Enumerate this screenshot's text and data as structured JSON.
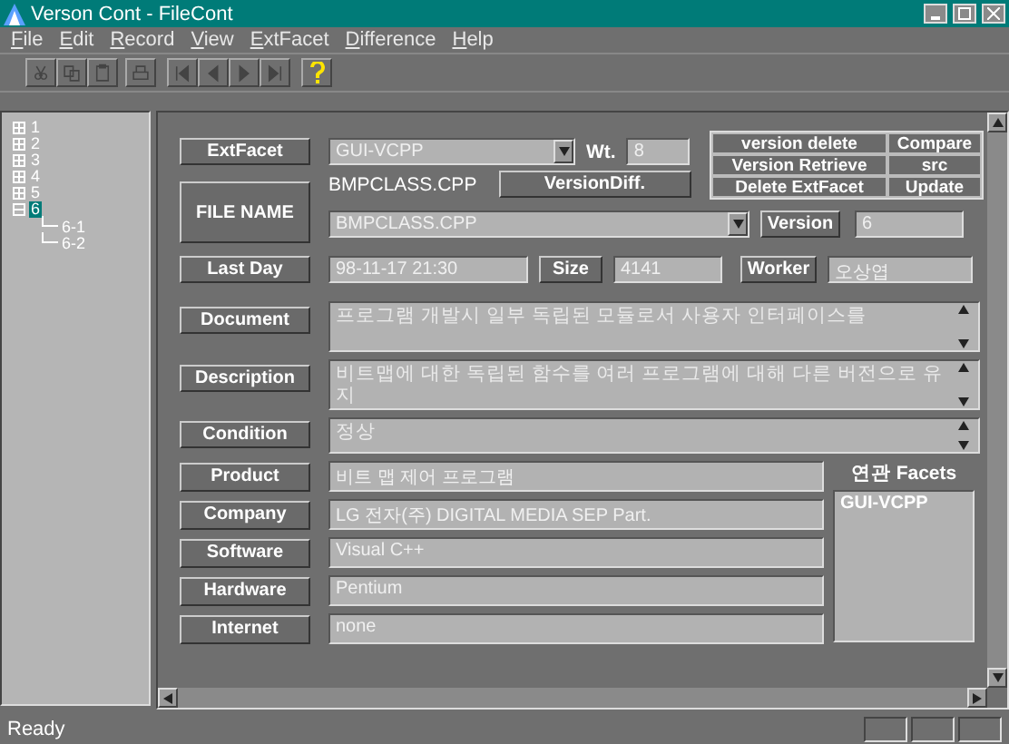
{
  "window": {
    "title": "Verson Cont - FileCont"
  },
  "menu": [
    "File",
    "Edit",
    "Record",
    "View",
    "ExtFacet",
    "Difference",
    "Help"
  ],
  "tree": [
    {
      "label": "1",
      "expanded": false,
      "selected": false
    },
    {
      "label": "2",
      "expanded": false,
      "selected": false
    },
    {
      "label": "3",
      "expanded": false,
      "selected": false
    },
    {
      "label": "4",
      "expanded": false,
      "selected": false
    },
    {
      "label": "5",
      "expanded": false,
      "selected": false
    },
    {
      "label": "6",
      "expanded": true,
      "selected": true,
      "children": [
        {
          "label": "6-1"
        },
        {
          "label": "6-2"
        }
      ]
    }
  ],
  "form": {
    "extfacet": {
      "label": "ExtFacet",
      "value": "GUI-VCPP",
      "wt_label": "Wt.",
      "wt": "8"
    },
    "actions": [
      "version delete",
      "Compare",
      "Version Retrieve",
      "src",
      "Delete ExtFacet",
      "Update"
    ],
    "file_name": {
      "label": "FILE NAME",
      "text": "BMPCLASS.CPP",
      "diff_button": "VersionDiff.",
      "value": "BMPCLASS.CPP",
      "version_button": "Version",
      "version": "6"
    },
    "last_day": {
      "label": "Last Day",
      "value": "98-11-17 21:30",
      "size_label": "Size",
      "size": "4141",
      "worker_label": "Worker",
      "worker": "오상엽"
    },
    "memos": [
      {
        "label": "Document",
        "value": "프로그램 개발시 일부 독립된 모듈로서 사용자 인터페이스를",
        "kind": "multiline"
      },
      {
        "label": "Description",
        "value": "비트맵에 대한 독립된 함수를 여러 프로그램에 대해 다른 버전으로 유지",
        "kind": "multiline"
      },
      {
        "label": "Condition",
        "value": "정상",
        "kind": "single"
      }
    ],
    "fields": [
      {
        "label": "Product",
        "value": "비트 맵 제어 프로그램"
      },
      {
        "label": "Company",
        "value": "LG 전자(주)  DIGITAL MEDIA SEP Part."
      },
      {
        "label": "Software",
        "value": "Visual C++"
      },
      {
        "label": "Hardware",
        "value": "Pentium"
      },
      {
        "label": "Internet",
        "value": "none"
      }
    ],
    "facets": {
      "title": "연관 Facets",
      "items": [
        "GUI-VCPP"
      ]
    }
  },
  "status_bar": {
    "text": "Ready"
  }
}
